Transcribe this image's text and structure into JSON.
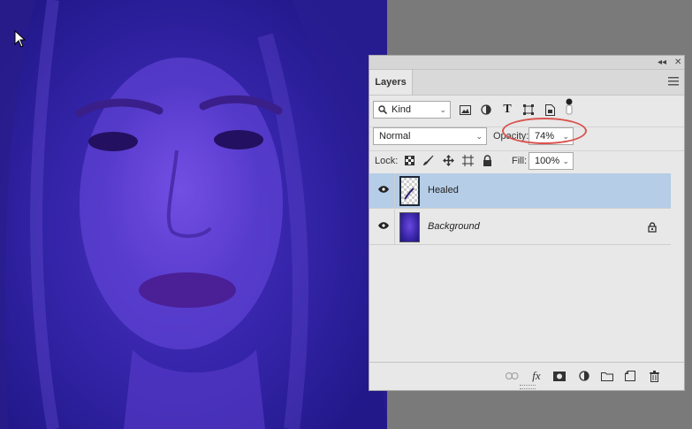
{
  "panel": {
    "collapse_glyph": "◂◂",
    "close_glyph": "✕",
    "tab_label": "Layers",
    "filter_kind": "Kind",
    "blend_mode": "Normal",
    "opacity_label": "Opacity:",
    "opacity_value": "74%",
    "lock_label": "Lock:",
    "fill_label": "Fill:",
    "fill_value": "100%",
    "layers": [
      {
        "name": "Healed",
        "visible": true,
        "selected": true,
        "locked": false
      },
      {
        "name": "Background",
        "visible": true,
        "selected": false,
        "locked": true
      }
    ]
  },
  "colors": {
    "selected_row": "#b5cde6",
    "annotation": "#d9544f"
  },
  "icons": {
    "filter": [
      "image-filter-icon",
      "adjustment-filter-icon",
      "type-filter-icon",
      "shape-filter-icon",
      "smart-object-filter-icon",
      "filter-toggle-icon"
    ],
    "lock": [
      "lock-transparency-icon",
      "lock-image-icon",
      "lock-position-icon",
      "lock-artboard-icon",
      "lock-all-icon"
    ],
    "bottom": [
      "link-layers-icon",
      "fx-icon",
      "add-mask-icon",
      "adjustment-layer-icon",
      "new-group-icon",
      "new-layer-icon",
      "trash-icon"
    ]
  }
}
